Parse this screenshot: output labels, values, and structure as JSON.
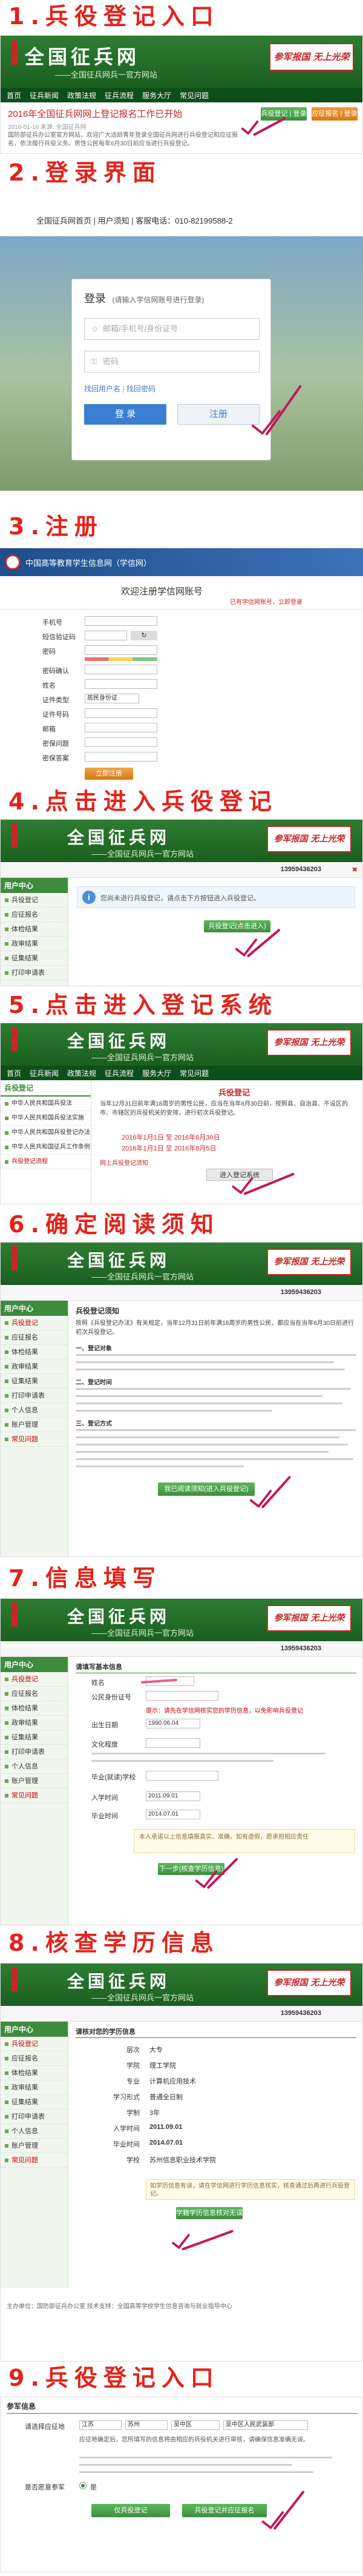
{
  "steps": {
    "s1": "1.兵役登记入口",
    "s2": "2.登录界面",
    "s3": "3.注册",
    "s4": "4.点击进入兵役登记",
    "s5": "5.点击进入登记系统",
    "s6": "6.确定阅读须知",
    "s7": "7.信息填写",
    "s8": "8.核查学历信息",
    "s9": "9.兵役登记入口"
  },
  "site": {
    "logo": "全国征兵网",
    "subtitle": "——全国征兵网兵一官方网站",
    "slogan": "参军报国 无上光荣",
    "phone": "13959436203"
  },
  "shot1": {
    "notice": "2016年全国征兵网网上登记报名工作已开始",
    "sub": "2016-01-16 来源: 全国征兵网",
    "btn1": "兵役登记 | 登录",
    "btn2": "应征报名 | 登录",
    "body": "国防部征兵办公室官方网站，欢迎广大适龄青年登录全国征兵网进行兵役登记和应征报名，依法履行兵役义务。男性公民每年6月30日前应当进行兵役登记。"
  },
  "shot2": {
    "header_links": "全国征兵网首页  |  用户须知  |  客服电话：010-82199588-2",
    "title": "登录",
    "title_hint": "(请输入学信网账号进行登录)",
    "user_placeholder": "邮箱/手机号/身份证号",
    "pwd_placeholder": "密码",
    "forgot": "找回用户名",
    "forgot2": "找回密码",
    "login": "登 录",
    "register": "注册"
  },
  "shot3": {
    "brand": "中国高等教育学生信息网（学信网）",
    "welcome": "欢迎注册学信网账号",
    "link_text": "已有学信网账号，立即登录",
    "label_phone": "手机号",
    "label_code": "短信验证码",
    "label_pwd": "密码",
    "label_pwd2": "密码确认",
    "label_name": "姓名",
    "label_idtype": "证件类型",
    "label_id": "证件号码",
    "label_email": "邮箱",
    "label_q": "密保问题",
    "label_a": "密保答案",
    "idtype_value": "居民身份证",
    "submit": "立即注册"
  },
  "shot4": {
    "phone_label": "13959436203",
    "menu_head": "用户中心",
    "menu": [
      "兵役登记",
      "兵役登记",
      "应征报名",
      "体检结果",
      "政审结果",
      "征集结果",
      "打印申请表",
      "个人信息",
      "账户管理"
    ],
    "info": "您尚未进行兵役登记，请点击下方按钮进入兵役登记。",
    "button": "兵役登记(点击进入)"
  },
  "shot5": {
    "menu_head": "兵役登记",
    "menu": [
      "中华人民共和国兵役法",
      "中华人民共和国兵役法实施",
      "中华人民共和国兵役登记办法",
      "中华人民共和国征兵工作条例",
      "兵役登记流程"
    ],
    "panel_title": "兵役登记",
    "body": "当年12月31日前年满18周岁的男性公民，应当在当年6月30日前，按照县、自治县、不设区的市、市辖区的兵役机关的安排，进行初次兵役登记。",
    "date1": "2016年1月1日 至 2016年6月30日",
    "date2": "2016年1月1日 至 2016年8月5日",
    "button": "进入登记系统",
    "red_link": "网上兵役登记须知"
  },
  "shot6": {
    "phone_label": "13959436203",
    "menu_head": "用户中心",
    "menu": [
      "兵役登记",
      "应征报名",
      "体检结果",
      "政审结果",
      "征集结果",
      "打印申请表",
      "个人信息",
      "账户管理",
      "常见问题"
    ],
    "title": "兵役登记须知",
    "p1": "按照《兵役登记办法》有关规定，当年12月31日前年满18周岁的男性公民，都应当在当年6月30日前进行初次兵役登记。",
    "p2": "一、登记对象",
    "p3": "二、登记时间",
    "p4": "三、登记方式",
    "button": "我已阅读须知(进入兵役登记)"
  },
  "shot7": {
    "phone_label": "13959436203",
    "menu_head": "用户中心",
    "menu": [
      "兵役登记",
      "应征报名",
      "体检结果",
      "政审结果",
      "征集结果",
      "打印申请表",
      "个人信息",
      "账户管理",
      "常见问题"
    ],
    "section": "请填写基本信息",
    "label_name": "姓名",
    "label_id": "公民身份证号",
    "label_birth": "出生日期",
    "label_culture": "文化程度",
    "label_school": "毕业(就读)学校",
    "label_enter": "入学时间",
    "label_grad": "毕业时间",
    "value_birth": "1990.06.04",
    "value_enter": "2011.09.01",
    "value_grad": "2014.07.01",
    "warn": "提示：请先在学信网核实您的学历信息，以免影响兵役登记",
    "notice": "本人承诺以上信息填报真实、准确，如有虚假，愿承担相应责任",
    "button": "下一步(核查学历信息)"
  },
  "shot8": {
    "phone_label": "13959436203",
    "menu_head": "用户中心",
    "menu": [
      "兵役登记",
      "应征报名",
      "体检结果",
      "政审结果",
      "征集结果",
      "打印申请表",
      "个人信息",
      "账户管理",
      "常见问题"
    ],
    "section": "请核对您的学历信息",
    "rows": [
      {
        "label": "层次",
        "value": "大专"
      },
      {
        "label": "学院",
        "value": "理工学院"
      },
      {
        "label": "专业",
        "value": "计算机应用技术"
      },
      {
        "label": "学习形式",
        "value": "普通全日制"
      },
      {
        "label": "学制",
        "value": "3年"
      },
      {
        "label": "入学时间",
        "value": "2011.09.01"
      },
      {
        "label": "毕业时间",
        "value": "2014.07.01"
      },
      {
        "label": "学校",
        "value": "苏州信息职业技术学院"
      }
    ],
    "tip": "如学历信息有误，请在学信网进行学历信息核实，核查通过后再进行兵役登记。",
    "button": "学籍学历信息核对无误",
    "footer": "主办单位：国防部征兵办公室  技术支持：全国高等学校学生信息咨询与就业指导中心"
  },
  "shot9": {
    "section": "参军信息",
    "label_place": "请选择应征地",
    "sel1": "江苏",
    "sel2": "苏州",
    "sel3": "吴中区",
    "sel4": "吴中区人民武装部",
    "text": "应征地确定后，您所填写的信息将由相应的兵役机关进行审核，请确保信息准确无误。",
    "label_agree": "是否愿意参军",
    "opt1": "是",
    "btn1": "仅兵役登记",
    "btn2": "兵役登记并应征报名"
  }
}
